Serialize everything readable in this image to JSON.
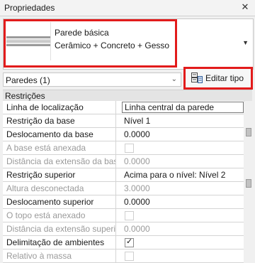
{
  "panel": {
    "title": "Propriedades",
    "close_icon": "close-icon"
  },
  "type_selector": {
    "name": "Parede básica",
    "description": "Cerâmico + Concreto + Gesso",
    "thumbnail_icon": "wall-type-icon",
    "dropdown_icon": "dropdown-arrow-icon"
  },
  "instance_filter": {
    "label": "Paredes (1)"
  },
  "edit_type": {
    "label": "Editar tipo",
    "icon": "edit-type-icon"
  },
  "section": {
    "label": "Restrições"
  },
  "properties": [
    {
      "name": "Linha de localização",
      "value": "Linha central da parede"
    },
    {
      "name": "Restrição da base",
      "value": "Nível 1"
    },
    {
      "name": "Deslocamento da base",
      "value": "0.0000"
    },
    {
      "name": "A base está anexada",
      "value": ""
    },
    {
      "name": "Distância da extensão da base",
      "value": "0.0000"
    },
    {
      "name": "Restrição superior",
      "value": "Acima para o nível: Nível 2"
    },
    {
      "name": "Altura desconectada",
      "value": "3.0000"
    },
    {
      "name": "Deslocamento superior",
      "value": "0.0000"
    },
    {
      "name": "O topo está anexado",
      "value": ""
    },
    {
      "name": "Distância da extensão superior",
      "value": "0.0000"
    },
    {
      "name": "Delimitação de ambientes",
      "value": ""
    },
    {
      "name": "Relativo à massa",
      "value": ""
    }
  ],
  "colors": {
    "highlight": "#e21b1b",
    "disabled_text": "#9a9a9a"
  }
}
